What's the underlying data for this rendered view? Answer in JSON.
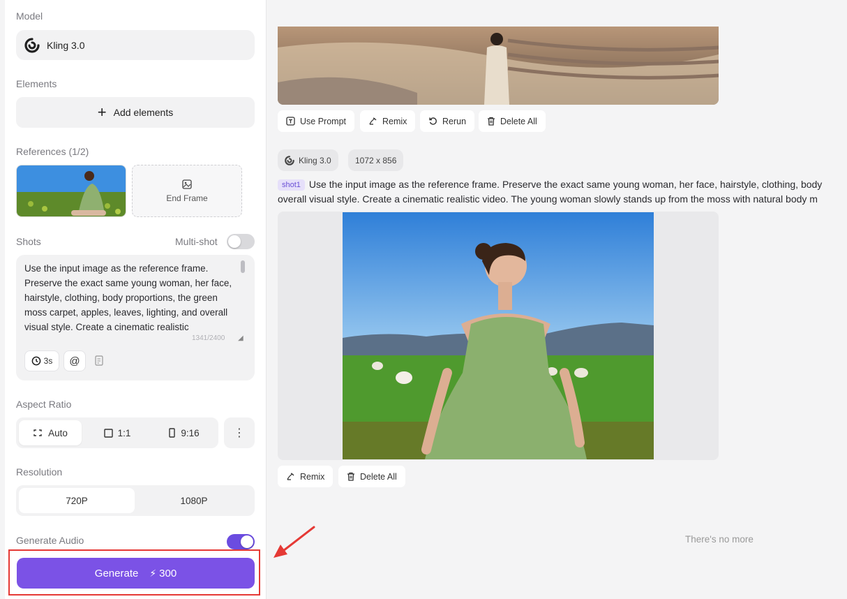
{
  "sidebar": {
    "model_label": "Model",
    "model_name": "Kling 3.0",
    "elements_label": "Elements",
    "add_elements": "Add elements",
    "references_label": "References (1/2)",
    "end_frame": "End Frame",
    "shots_label": "Shots",
    "multishot_label": "Multi-shot",
    "multishot_on": false,
    "prompt_text": "Use the input image as the reference frame. Preserve the exact same young woman, her face, hairstyle, clothing, body proportions, the green moss carpet, apples, leaves, lighting, and overall visual style. Create a cinematic realistic",
    "char_count": "1341/2400",
    "duration_chip": "3s",
    "mention_chip": "@",
    "aspect_ratio_label": "Aspect Ratio",
    "aspect_options": [
      "Auto",
      "1:1",
      "9:16"
    ],
    "aspect_selected": "Auto",
    "resolution_label": "Resolution",
    "resolution_options": [
      "720P",
      "1080P"
    ],
    "resolution_selected": "720P",
    "audio_label": "Generate Audio",
    "audio_on": true,
    "generate_label": "Generate",
    "generate_cost": "300"
  },
  "main": {
    "top_actions": [
      "Use Prompt",
      "Remix",
      "Rerun",
      "Delete All"
    ],
    "tag_model": "Kling 3.0",
    "tag_size": "1072 x 856",
    "shot_badge": "shot1",
    "prompt_line1": "Use the input image as the reference frame. Preserve the exact same young woman, her face, hairstyle, clothing, body",
    "prompt_line2": "overall visual style. Create a cinematic realistic video. The young woman slowly stands up from the moss with natural body m",
    "bottom_actions": [
      "Remix",
      "Delete All"
    ],
    "no_more": "There's no more"
  },
  "colors": {
    "accent": "#7b52e6",
    "highlight_box": "#e53935"
  }
}
